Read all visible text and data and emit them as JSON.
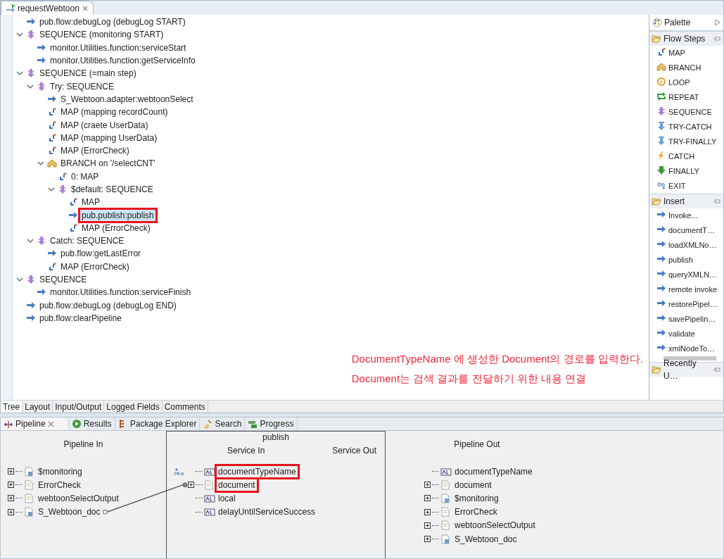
{
  "editor_tab": {
    "title": "requestWebtoon"
  },
  "flow_tree": [
    {
      "label": "pub.flow:debugLog (debugLog START)",
      "kind": "invoke"
    },
    {
      "label": "SEQUENCE (monitoring START)",
      "kind": "sequence",
      "expanded": true,
      "children": [
        {
          "label": "monitor.Utilities.function:serviceStart",
          "kind": "invoke"
        },
        {
          "label": "monitor.Utilities.function:getServiceInfo",
          "kind": "invoke"
        }
      ]
    },
    {
      "label": "SEQUENCE (=main step)",
      "kind": "sequence",
      "expanded": true,
      "children": [
        {
          "label": "Try: SEQUENCE",
          "kind": "sequence",
          "expanded": true,
          "children": [
            {
              "label": "S_Webtoon.adapter:webtoonSelect",
              "kind": "invoke"
            },
            {
              "label": "MAP (mapping recordCount)",
              "kind": "map"
            },
            {
              "label": "MAP (craete UserData)",
              "kind": "map"
            },
            {
              "label": "MAP (mapping UserData)",
              "kind": "map"
            },
            {
              "label": "MAP (ErrorCheck)",
              "kind": "map"
            },
            {
              "label": "BRANCH on '/selectCNT'",
              "kind": "branch",
              "expanded": true,
              "children": [
                {
                  "label": "0: MAP",
                  "kind": "map"
                },
                {
                  "label": "$default: SEQUENCE",
                  "kind": "sequence",
                  "expanded": true,
                  "children": [
                    {
                      "label": "MAP",
                      "kind": "map"
                    },
                    {
                      "label": "pub.publish:publish",
                      "kind": "invoke",
                      "selected": true,
                      "highlighted": true
                    },
                    {
                      "label": "MAP (ErrorCheck)",
                      "kind": "map"
                    }
                  ]
                }
              ]
            }
          ]
        },
        {
          "label": "Catch: SEQUENCE",
          "kind": "sequence",
          "expanded": true,
          "children": [
            {
              "label": "pub.flow:getLastError",
              "kind": "invoke"
            },
            {
              "label": "MAP (ErrorCheck)",
              "kind": "map"
            }
          ]
        }
      ]
    },
    {
      "label": "SEQUENCE",
      "kind": "sequence",
      "expanded": true,
      "children": [
        {
          "label": "monitor.Utilities.function:serviceFinish",
          "kind": "invoke"
        }
      ]
    },
    {
      "label": "pub.flow:debugLog (debugLog END)",
      "kind": "invoke"
    },
    {
      "label": "pub.flow:clearPipeline",
      "kind": "invoke"
    }
  ],
  "annotation": [
    "DocumentTypeName 에 생성한 Document의 경로를 입력한다.",
    "Document는 검색 결과를 전달하기 위한 내용 연결"
  ],
  "editor_tabs": [
    {
      "label": "Tree",
      "selected": true
    },
    {
      "label": "Layout",
      "selected": false
    },
    {
      "label": "Input/Output",
      "selected": false
    },
    {
      "label": "Logged Fields",
      "selected": false
    },
    {
      "label": "Comments",
      "selected": false
    }
  ],
  "palette": {
    "title": "Palette",
    "sections": [
      {
        "title": "Flow Steps",
        "items": [
          {
            "label": "MAP",
            "kind": "map"
          },
          {
            "label": "BRANCH",
            "kind": "branch"
          },
          {
            "label": "LOOP",
            "kind": "loop"
          },
          {
            "label": "REPEAT",
            "kind": "repeat"
          },
          {
            "label": "SEQUENCE",
            "kind": "sequence"
          },
          {
            "label": "TRY-CATCH",
            "kind": "try"
          },
          {
            "label": "TRY-FINALLY",
            "kind": "try"
          },
          {
            "label": "CATCH",
            "kind": "catch"
          },
          {
            "label": "FINALLY",
            "kind": "finally"
          },
          {
            "label": "EXIT",
            "kind": "exit"
          }
        ]
      },
      {
        "title": "Insert",
        "items": [
          {
            "label": "Invoke...",
            "kind": "invoke"
          },
          {
            "label": "documentT…",
            "kind": "invoke"
          },
          {
            "label": "loadXMLNo…",
            "kind": "invoke"
          },
          {
            "label": "publish",
            "kind": "invoke"
          },
          {
            "label": "queryXMLN…",
            "kind": "invoke"
          },
          {
            "label": "remote invoke",
            "kind": "invoke"
          },
          {
            "label": "restorePipel…",
            "kind": "invoke"
          },
          {
            "label": "savePipelin…",
            "kind": "invoke"
          },
          {
            "label": "validate",
            "kind": "invoke"
          },
          {
            "label": "xmlNodeTo…",
            "kind": "invoke"
          }
        ]
      },
      {
        "title": "Recently U…"
      }
    ]
  },
  "views": [
    {
      "label": "Pipeline",
      "kind": "pipeline",
      "selected": true
    },
    {
      "label": "Results",
      "kind": "results",
      "selected": false
    },
    {
      "label": "Package Explorer",
      "kind": "package",
      "selected": false
    },
    {
      "label": "Search",
      "kind": "search",
      "selected": false
    },
    {
      "label": "Progress",
      "kind": "progress",
      "selected": false
    }
  ],
  "pipeline": {
    "in": {
      "title": "Pipeline In",
      "fields": [
        {
          "label": "$monitoring",
          "kind": "docref",
          "expandable": true,
          "connected": false
        },
        {
          "label": "ErrorCheck",
          "kind": "document",
          "expandable": true,
          "connected": false
        },
        {
          "label": "webtoonSelectOutput",
          "kind": "document",
          "expandable": true,
          "connected": false
        },
        {
          "label": "S_Webtoon_doc",
          "kind": "docref",
          "expandable": true,
          "connected": true
        }
      ]
    },
    "service": {
      "title": "publish",
      "in_title": "Service In",
      "out_title": "Service Out",
      "fields": [
        {
          "label": "documentTypeName",
          "kind": "string",
          "expandable": false,
          "value_set": true,
          "highlighted": true,
          "connected": false
        },
        {
          "label": "document",
          "kind": "document",
          "expandable": true,
          "value_set": false,
          "highlighted": true,
          "connected": true
        },
        {
          "label": "local",
          "kind": "string",
          "expandable": false,
          "value_set": false,
          "highlighted": false,
          "connected": false
        },
        {
          "label": "delayUntilServiceSuccess",
          "kind": "string",
          "expandable": false,
          "value_set": false,
          "highlighted": false,
          "connected": false
        }
      ]
    },
    "out": {
      "title": "Pipeline Out",
      "fields": [
        {
          "label": "documentTypeName",
          "kind": "string",
          "expandable": false
        },
        {
          "label": "document",
          "kind": "document",
          "expandable": true
        },
        {
          "label": "$monitoring",
          "kind": "docref",
          "expandable": true
        },
        {
          "label": "ErrorCheck",
          "kind": "document",
          "expandable": true
        },
        {
          "label": "webtoonSelectOutput",
          "kind": "document",
          "expandable": true
        },
        {
          "label": "S_Webtoon_doc",
          "kind": "docref",
          "expandable": true
        }
      ]
    }
  }
}
